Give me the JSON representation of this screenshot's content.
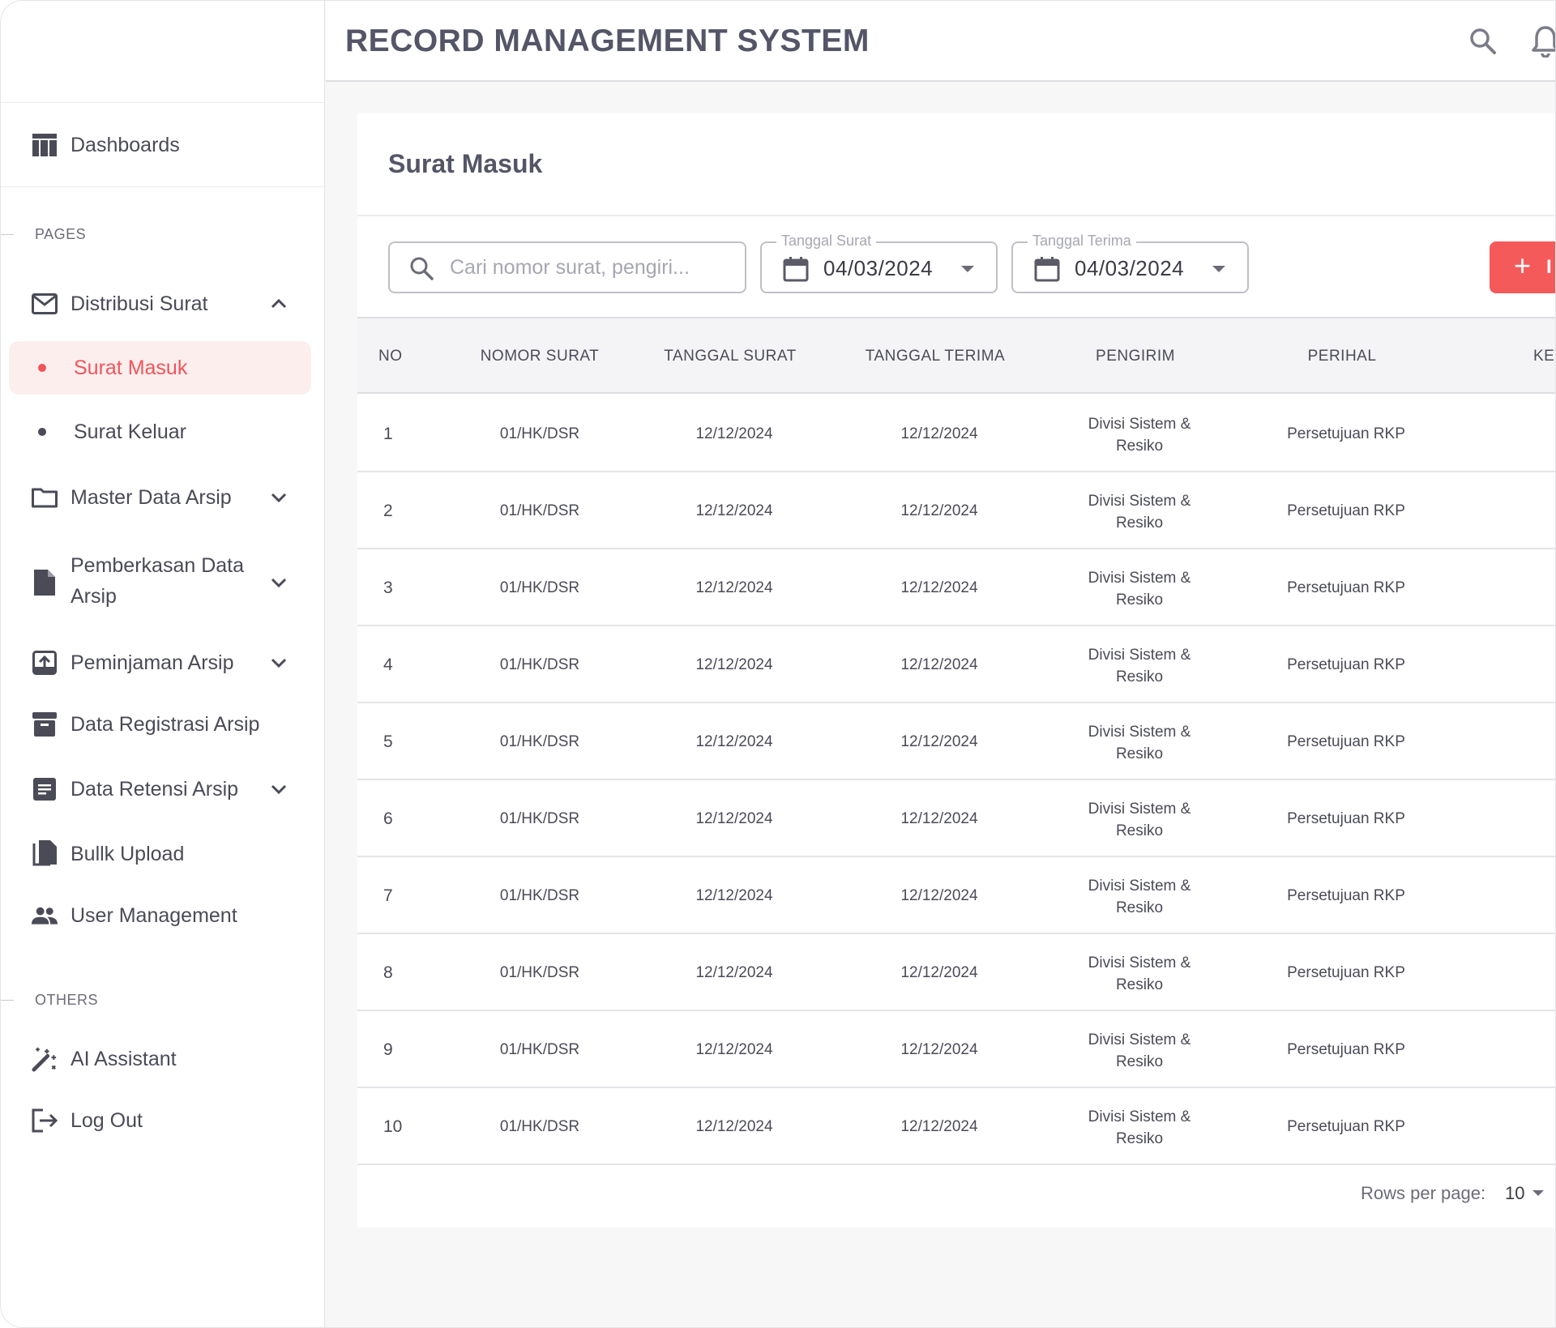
{
  "header": {
    "title": "RECORD MANAGEMENT SYSTEM"
  },
  "sidebar": {
    "dashboards": "Dashboards",
    "pages_label": "PAGES",
    "distribusi_surat": "Distribusi Surat",
    "surat_masuk": "Surat Masuk",
    "surat_keluar": "Surat Keluar",
    "master_data_arsip": "Master Data Arsip",
    "pemberkasan_line1": "Pemberkasan Data",
    "pemberkasan_line2": "Arsip",
    "peminjaman_arsip": "Peminjaman Arsip",
    "data_registrasi_arsip": "Data Registrasi Arsip",
    "data_retensi_arsip": "Data Retensi Arsip",
    "bulk_upload": "Bullk Upload",
    "user_management": "User Management",
    "others_label": "OTHERS",
    "ai_assistant": "AI Assistant",
    "log_out": "Log Out"
  },
  "page": {
    "title": "Surat Masuk",
    "search_placeholder": "Cari nomor surat, pengiri...",
    "tanggal_surat_label": "Tanggal Surat",
    "tanggal_surat_value": "04/03/2024",
    "tanggal_terima_label": "Tanggal Terima",
    "tanggal_terima_value": "04/03/2024",
    "add_button_plus": "+",
    "add_button_text": "I"
  },
  "table": {
    "columns": [
      "NO",
      "NOMOR SURAT",
      "TANGGAL SURAT",
      "TANGGAL TERIMA",
      "PENGIRIM",
      "PERIHAL",
      "KET"
    ],
    "rows": [
      {
        "no": "1",
        "nomor": "01/HK/DSR",
        "tgl_surat": "12/12/2024",
        "tgl_terima": "12/12/2024",
        "pengirim_1": "Divisi Sistem &",
        "pengirim_2": "Resiko",
        "perihal": "Persetujuan RKP",
        "ket": "-"
      },
      {
        "no": "2",
        "nomor": "01/HK/DSR",
        "tgl_surat": "12/12/2024",
        "tgl_terima": "12/12/2024",
        "pengirim_1": "Divisi Sistem &",
        "pengirim_2": "Resiko",
        "perihal": "Persetujuan RKP",
        "ket": "-"
      },
      {
        "no": "3",
        "nomor": "01/HK/DSR",
        "tgl_surat": "12/12/2024",
        "tgl_terima": "12/12/2024",
        "pengirim_1": "Divisi Sistem &",
        "pengirim_2": "Resiko",
        "perihal": "Persetujuan RKP",
        "ket": "-"
      },
      {
        "no": "4",
        "nomor": "01/HK/DSR",
        "tgl_surat": "12/12/2024",
        "tgl_terima": "12/12/2024",
        "pengirim_1": "Divisi Sistem &",
        "pengirim_2": "Resiko",
        "perihal": "Persetujuan RKP",
        "ket": "-"
      },
      {
        "no": "5",
        "nomor": "01/HK/DSR",
        "tgl_surat": "12/12/2024",
        "tgl_terima": "12/12/2024",
        "pengirim_1": "Divisi Sistem &",
        "pengirim_2": "Resiko",
        "perihal": "Persetujuan RKP",
        "ket": "-"
      },
      {
        "no": "6",
        "nomor": "01/HK/DSR",
        "tgl_surat": "12/12/2024",
        "tgl_terima": "12/12/2024",
        "pengirim_1": "Divisi Sistem &",
        "pengirim_2": "Resiko",
        "perihal": "Persetujuan RKP",
        "ket": "-"
      },
      {
        "no": "7",
        "nomor": "01/HK/DSR",
        "tgl_surat": "12/12/2024",
        "tgl_terima": "12/12/2024",
        "pengirim_1": "Divisi Sistem &",
        "pengirim_2": "Resiko",
        "perihal": "Persetujuan RKP",
        "ket": "-"
      },
      {
        "no": "8",
        "nomor": "01/HK/DSR",
        "tgl_surat": "12/12/2024",
        "tgl_terima": "12/12/2024",
        "pengirim_1": "Divisi Sistem &",
        "pengirim_2": "Resiko",
        "perihal": "Persetujuan RKP",
        "ket": "-"
      },
      {
        "no": "9",
        "nomor": "01/HK/DSR",
        "tgl_surat": "12/12/2024",
        "tgl_terima": "12/12/2024",
        "pengirim_1": "Divisi Sistem &",
        "pengirim_2": "Resiko",
        "perihal": "Persetujuan RKP",
        "ket": "-"
      },
      {
        "no": "10",
        "nomor": "01/HK/DSR",
        "tgl_surat": "12/12/2024",
        "tgl_terima": "12/12/2024",
        "pengirim_1": "Divisi Sistem &",
        "pengirim_2": "Resiko",
        "perihal": "Persetujuan RKP",
        "ket": "-"
      }
    ]
  },
  "pagination": {
    "rows_per_page_label": "Rows per page:",
    "rows_per_page_value": "10"
  },
  "colors": {
    "accent": "#f0555a",
    "active_bg": "#fdeeee",
    "text": "#4a4b57",
    "title": "#545567"
  },
  "icons": [
    "table-icon",
    "mail-icon",
    "folder-icon",
    "document-icon",
    "box-upload-icon",
    "archive-icon",
    "list-icon",
    "files-icon",
    "users-icon",
    "magic-wand-icon",
    "logout-icon",
    "search-icon",
    "bell-icon",
    "calendar-icon",
    "chevron-up-icon",
    "chevron-down-icon"
  ]
}
